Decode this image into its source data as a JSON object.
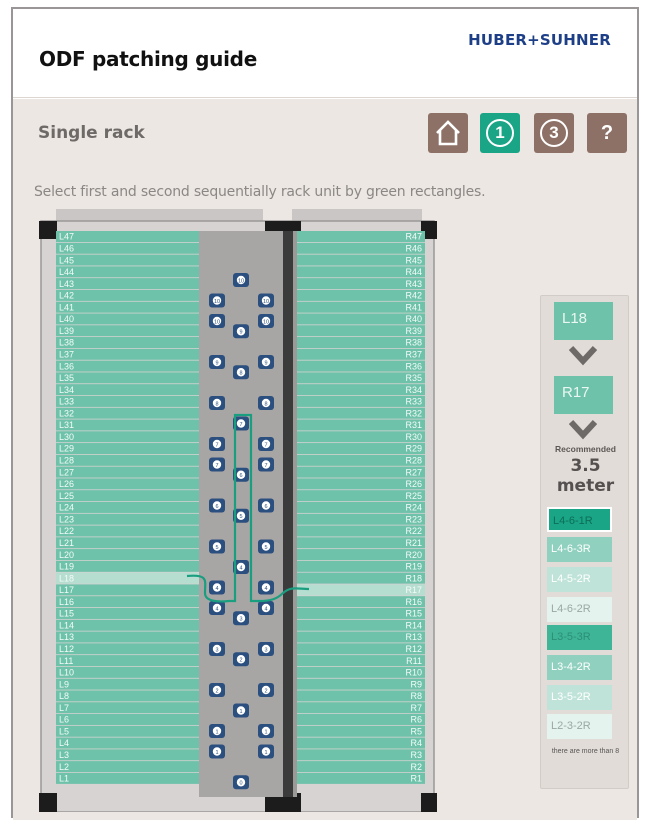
{
  "header": {
    "title": "ODF patching guide",
    "brand": "HUBER+SUHNER"
  },
  "main": {
    "subtitle": "Single rack",
    "instruction": "Select first and second sequentially rack unit by green rectangles."
  },
  "nav": {
    "home_icon": "home-icon",
    "step1": "1",
    "step3": "3",
    "help": "?",
    "active_color": "#1aa586",
    "inactive_color": "#8d7166"
  },
  "rack": {
    "left_units": [
      "L47",
      "L46",
      "L45",
      "L44",
      "L43",
      "L42",
      "L41",
      "L40",
      "L39",
      "L38",
      "L37",
      "L36",
      "L35",
      "L34",
      "L33",
      "L32",
      "L31",
      "L30",
      "L29",
      "L28",
      "L27",
      "L26",
      "L25",
      "L24",
      "L23",
      "L22",
      "L21",
      "L20",
      "L19",
      "L18",
      "L17",
      "L16",
      "L15",
      "L14",
      "L13",
      "L12",
      "L11",
      "L10",
      "L9",
      "L8",
      "L7",
      "L6",
      "L5",
      "L4",
      "L3",
      "L2",
      "L1"
    ],
    "right_units": [
      "R47",
      "R46",
      "R45",
      "R44",
      "R43",
      "R42",
      "R41",
      "R40",
      "R39",
      "R38",
      "R37",
      "R36",
      "R35",
      "R34",
      "R33",
      "R32",
      "R31",
      "R30",
      "R29",
      "R28",
      "R27",
      "R26",
      "R25",
      "R24",
      "R23",
      "R22",
      "R21",
      "R20",
      "R19",
      "R18",
      "R17",
      "R16",
      "R15",
      "R14",
      "R13",
      "R12",
      "R11",
      "R10",
      "R9",
      "R8",
      "R7",
      "R6",
      "R5",
      "R4",
      "R3",
      "R2",
      "R1"
    ],
    "selected_left": "L18",
    "selected_right": "R17",
    "unit_color": "#6fc2aa",
    "selected_unit_color": "#b5ddd0",
    "cable_color": "#1a9e80",
    "guides": [
      {
        "row": 4,
        "side": "center",
        "label": "10"
      },
      {
        "row": 6,
        "side": "pair",
        "label": "10"
      },
      {
        "row": 8,
        "side": "pair",
        "label": "10"
      },
      {
        "row": 9,
        "side": "center",
        "label": "9"
      },
      {
        "row": 12,
        "side": "pair",
        "label": "9"
      },
      {
        "row": 13,
        "side": "center",
        "label": "8"
      },
      {
        "row": 16,
        "side": "pair",
        "label": "8"
      },
      {
        "row": 18,
        "side": "center",
        "label": "7"
      },
      {
        "row": 20,
        "side": "pair",
        "label": "7"
      },
      {
        "row": 22,
        "side": "pair",
        "label": "7"
      },
      {
        "row": 23,
        "side": "center",
        "label": "6"
      },
      {
        "row": 26,
        "side": "pair",
        "label": "6"
      },
      {
        "row": 27,
        "side": "center",
        "label": "5"
      },
      {
        "row": 30,
        "side": "pair",
        "label": "5"
      },
      {
        "row": 32,
        "side": "center",
        "label": "4"
      },
      {
        "row": 34,
        "side": "pair",
        "label": "4"
      },
      {
        "row": 36,
        "side": "pair",
        "label": "4"
      },
      {
        "row": 37,
        "side": "center",
        "label": "3"
      },
      {
        "row": 40,
        "side": "pair",
        "label": "3"
      },
      {
        "row": 41,
        "side": "center",
        "label": "2"
      },
      {
        "row": 44,
        "side": "pair",
        "label": "2"
      },
      {
        "row": 46,
        "side": "center",
        "label": "1"
      },
      {
        "row": 48,
        "side": "pair",
        "label": "1"
      },
      {
        "row": 50,
        "side": "pair",
        "label": "1"
      },
      {
        "row": 53,
        "side": "center",
        "label": "0"
      }
    ]
  },
  "panel": {
    "first": "L18",
    "second": "R17",
    "recommended_label": "Recommended",
    "recommended_value": "3.5 meter",
    "options": [
      {
        "label": "L4-6-1R",
        "bg": "#1aa586",
        "fg": "#0c6e58",
        "border": "#ffffff"
      },
      {
        "label": "L4-6-3R",
        "bg": "#8fd0be",
        "fg": "#ffffff",
        "border": ""
      },
      {
        "label": "L4-5-2R",
        "bg": "#bfe3d8",
        "fg": "#ffffff",
        "border": ""
      },
      {
        "label": "L4-6-2R",
        "bg": "#e5f3ee",
        "fg": "#9aa8a4",
        "border": ""
      },
      {
        "label": "L3-5-3R",
        "bg": "#3fb598",
        "fg": "#2a8f76",
        "border": ""
      },
      {
        "label": "L3-4-2R",
        "bg": "#8fd0be",
        "fg": "#ffffff",
        "border": ""
      },
      {
        "label": "L3-5-2R",
        "bg": "#bfe3d8",
        "fg": "#ffffff",
        "border": ""
      },
      {
        "label": "L2-3-2R",
        "bg": "#e5f3ee",
        "fg": "#9aa8a4",
        "border": ""
      }
    ],
    "more_note": "there are more than 8"
  }
}
